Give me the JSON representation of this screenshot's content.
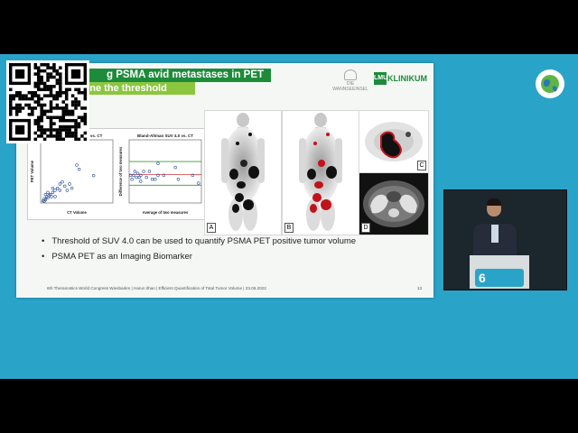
{
  "slide": {
    "title": "g PSMA avid metastases in PET",
    "subtitle": "How to define the threshold",
    "logos": {
      "univ": "DIE WANNSEEINSEL",
      "klinikum_mark": "LMU",
      "klinikum_name": "KLINIKUM"
    },
    "bullets": [
      "Threshold of SUV 4.0 can be used to quantify PSMA PET positive tumor volume",
      "PSMA PET as an Imaging Biomarker"
    ],
    "footer": "6th Theranostics World Congress Wiesbaden | Harun Ilhan | Efficient Quantification of Total Tumor Volume | 23.06.2022",
    "page": "13",
    "panels": [
      "A",
      "B",
      "C",
      "D"
    ]
  },
  "chart_data": [
    {
      "type": "scatter",
      "title": "Correlation SUV 4.0 vs. CT",
      "xlabel": "CT Volume",
      "ylabel": "PET Volume",
      "points": [
        [
          1,
          1
        ],
        [
          1.5,
          2
        ],
        [
          2,
          1.5
        ],
        [
          2.5,
          3
        ],
        [
          3,
          2.5
        ],
        [
          3.5,
          3.5
        ],
        [
          4,
          4
        ],
        [
          4.5,
          3
        ],
        [
          5,
          5
        ],
        [
          6,
          6
        ],
        [
          7,
          7
        ],
        [
          8,
          6
        ],
        [
          9,
          10
        ],
        [
          10,
          8
        ],
        [
          11,
          6
        ],
        [
          12,
          9
        ],
        [
          13,
          7
        ],
        [
          15,
          18
        ],
        [
          16,
          16
        ],
        [
          22,
          13
        ],
        [
          2,
          4
        ],
        [
          3,
          5
        ],
        [
          5,
          7
        ],
        [
          6,
          3
        ],
        [
          8,
          9
        ],
        [
          1.5,
          0.8
        ]
      ],
      "xlim": [
        0,
        30
      ],
      "ylim": [
        0,
        30
      ]
    },
    {
      "type": "scatter",
      "title": "Bland-Altman SUV 4.0 vs. CT",
      "xlabel": "Average of two measures",
      "ylabel": "Difference of two measures",
      "points": [
        [
          0.5,
          -1
        ],
        [
          1,
          -2
        ],
        [
          1.5,
          -1
        ],
        [
          2,
          0
        ],
        [
          2.5,
          -1.5
        ],
        [
          3,
          -0.5
        ],
        [
          3.5,
          -1.5
        ],
        [
          4,
          -1
        ],
        [
          5,
          0
        ],
        [
          6,
          -1.5
        ],
        [
          7,
          0
        ],
        [
          8,
          -2
        ],
        [
          10,
          -1
        ],
        [
          10,
          2
        ],
        [
          12,
          -1
        ],
        [
          16,
          1
        ],
        [
          17,
          -2
        ],
        [
          22,
          -1
        ],
        [
          24,
          -3
        ],
        [
          4,
          -2.5
        ],
        [
          9,
          -2
        ]
      ],
      "lines": [
        {
          "y": 2.5,
          "color": "#3a9a3a"
        },
        {
          "y": -0.8,
          "color": "#d23a3a"
        },
        {
          "y": -3.5,
          "color": "#3a9a3a"
        }
      ],
      "xlim": [
        0,
        25
      ],
      "ylim": [
        -8,
        8
      ]
    }
  ]
}
